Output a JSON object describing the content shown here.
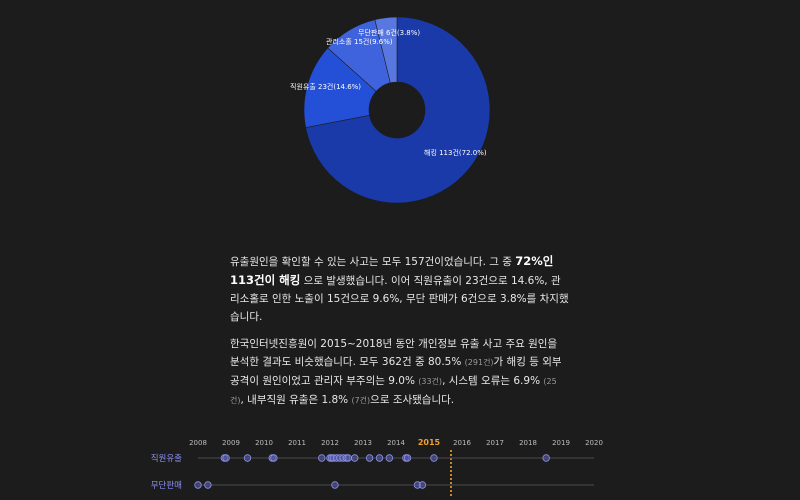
{
  "chart_data": [
    {
      "type": "pie",
      "categories": [
        "해킹",
        "직원유출",
        "관리소홀",
        "무단판매"
      ],
      "values": [
        113,
        23,
        15,
        6
      ],
      "percents": [
        "72.0%",
        "14.6%",
        "9.6%",
        "3.8%"
      ],
      "labels": [
        "해킹 113건(72.0%)",
        "직원유출 23건(14.6%)",
        "관리소홀 15건(9.6%)",
        "무단판매 6건(3.8%)"
      ],
      "colors": [
        "#1a3aaa",
        "#2450d8",
        "#3f63dc",
        "#5878e0"
      ]
    },
    {
      "type": "scatter",
      "x_ticks": [
        "2008",
        "2009",
        "2010",
        "2011",
        "2012",
        "2013",
        "2014",
        "2015",
        "2016",
        "2017",
        "2018",
        "2019",
        "2020"
      ],
      "highlight_year": "2015",
      "rows": [
        {
          "name": "직원유출",
          "x": [
            2008.8,
            2008.85,
            2009.5,
            2010.25,
            2010.3,
            2011.75,
            2012.0,
            2012.05,
            2012.1,
            2012.2,
            2012.3,
            2012.4,
            2012.5,
            2012.55,
            2012.75,
            2013.2,
            2013.5,
            2013.8,
            2014.3,
            2014.35,
            2015.15,
            2018.55
          ]
        },
        {
          "name": "무단판매",
          "x": [
            2008.0,
            2008.3,
            2012.15,
            2014.65,
            2014.8
          ]
        }
      ]
    }
  ],
  "article": {
    "p1_a": "유출원인을 확인할 수 있는 사고는 모두 157건이었습니다. 그 중 ",
    "p1_highlight": "72%인 113건이 해킹",
    "p1_b": " 으로 발생했습니다. 이어 직원유출이 23건으로 14.6%, 관리소홀로 인한 노출이 15건으로 9.6%, 무단 판매가 6건으로 3.8%를 차지했습니다.",
    "p2_a": "한국인터넷진흥원이 2015~2018년 동안 개인정보 유출 사고 주요 원인을 분석한 결과도 비슷했습니다. 모두 362건 중 80.5% ",
    "p2_s1": "(291건)",
    "p2_b": "가 해킹 등 외부 공격이 원인이었고 관리자 부주의는 9.0% ",
    "p2_s2": "(33건)",
    "p2_c": ", 시스템 오류는 6.9% ",
    "p2_s3": "(25건)",
    "p2_d": ", 내부직원 유출은 1.8% ",
    "p2_s4": "(7건)",
    "p2_e": "으로 조사됐습니다."
  }
}
